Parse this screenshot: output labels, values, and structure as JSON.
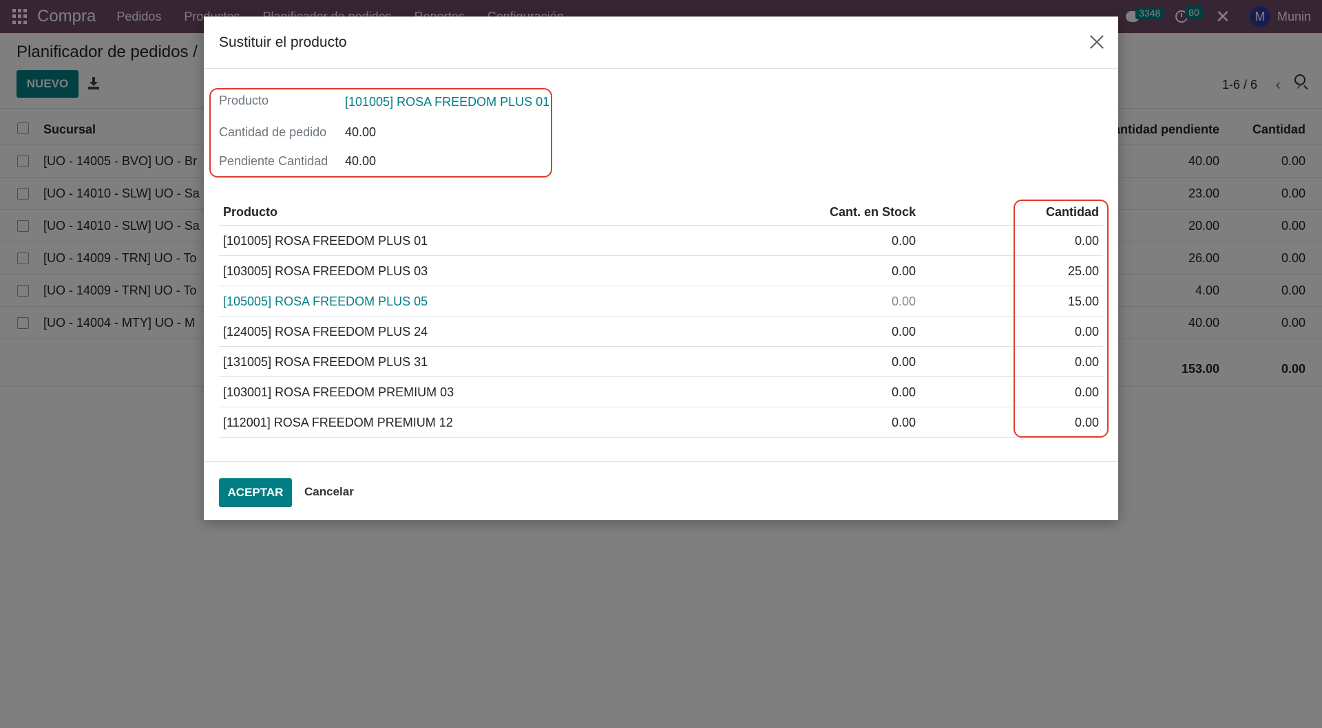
{
  "navbar": {
    "app_name": "Compra",
    "menu": [
      "Pedidos",
      "Productos",
      "Planificador de pedidos",
      "Reportes",
      "Configuración"
    ],
    "chat_count": "3348",
    "activity_count": "80",
    "user_initial": "M",
    "user_name": "Munin"
  },
  "page": {
    "breadcrumb": "Planificador de pedidos /",
    "new_button": "NUEVO",
    "pager": "1-6 / 6",
    "columns": {
      "sucursal": "Sucursal",
      "pendiente": "Cantidad pendiente",
      "cantidad": "Cantidad"
    },
    "rows": [
      {
        "name": "[UO - 14005 - BVO] UO - Br",
        "pendiente": "40.00",
        "cantidad": "0.00"
      },
      {
        "name": "[UO - 14010 - SLW] UO - Sa",
        "pendiente": "23.00",
        "cantidad": "0.00"
      },
      {
        "name": "[UO - 14010 - SLW] UO - Sa",
        "pendiente": "20.00",
        "cantidad": "0.00"
      },
      {
        "name": "[UO - 14009 - TRN] UO - To",
        "pendiente": "26.00",
        "cantidad": "0.00"
      },
      {
        "name": "[UO - 14009 - TRN] UO - To",
        "pendiente": "4.00",
        "cantidad": "0.00"
      },
      {
        "name": "[UO - 14004 - MTY] UO - M",
        "pendiente": "40.00",
        "cantidad": "0.00"
      }
    ],
    "totals": {
      "pendiente": "153.00",
      "cantidad": "0.00"
    }
  },
  "modal": {
    "title": "Sustituir el producto",
    "fields": {
      "producto_label": "Producto",
      "producto_value": "[101005] ROSA FREEDOM PLUS 01",
      "cantidad_pedido_label": "Cantidad de pedido",
      "cantidad_pedido_value": "40.00",
      "pendiente_label": "Pendiente Cantidad",
      "pendiente_value": "40.00"
    },
    "table": {
      "headers": {
        "producto": "Producto",
        "stock": "Cant. en Stock",
        "cantidad": "Cantidad"
      },
      "rows": [
        {
          "producto": "[101005] ROSA FREEDOM PLUS 01",
          "stock": "0.00",
          "cantidad": "0.00"
        },
        {
          "producto": "[103005] ROSA FREEDOM PLUS 03",
          "stock": "0.00",
          "cantidad": "25.00"
        },
        {
          "producto": "[105005] ROSA FREEDOM PLUS 05",
          "stock": "0.00",
          "cantidad": "15.00"
        },
        {
          "producto": "[124005] ROSA FREEDOM PLUS 24",
          "stock": "0.00",
          "cantidad": "0.00"
        },
        {
          "producto": "[131005] ROSA FREEDOM PLUS 31",
          "stock": "0.00",
          "cantidad": "0.00"
        },
        {
          "producto": "[103001] ROSA FREEDOM PREMIUM 03",
          "stock": "0.00",
          "cantidad": "0.00"
        },
        {
          "producto": "[112001] ROSA FREEDOM PREMIUM 12",
          "stock": "0.00",
          "cantidad": "0.00"
        }
      ]
    },
    "accept_button": "ACEPTAR",
    "cancel_button": "Cancelar"
  },
  "colors": {
    "navbar": "#714b67",
    "primary": "#017e84",
    "highlight": "#e13c2b"
  }
}
